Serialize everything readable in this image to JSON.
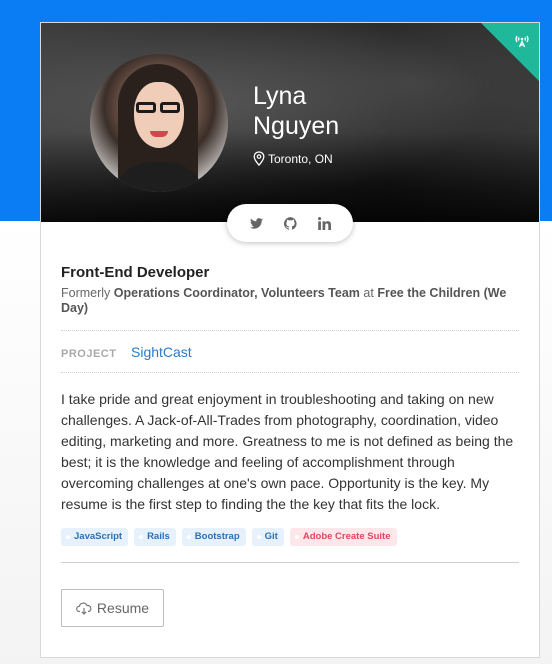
{
  "profile": {
    "first_name": "Lyna",
    "last_name": "Nguyen",
    "location": "Toronto, ON"
  },
  "social": {
    "icons": [
      "twitter-icon",
      "github-icon",
      "linkedin-icon"
    ]
  },
  "job": {
    "title": "Front-End Developer",
    "formerly_prefix": "Formerly",
    "former_role": "Operations Coordinator, Volunteers Team",
    "at": "at",
    "former_org": "Free the Children (We Day)"
  },
  "project": {
    "label": "PROJECT",
    "name": "SightCast"
  },
  "bio": "I take pride and great enjoyment in troubleshooting and taking on new challenges. A Jack-of-All-Trades from photography, coordination, video editing, marketing and more.   Greatness to me is not defined as being the best; it is the knowledge and feeling of accomplishment through overcoming challenges at one's own pace.  Opportunity is the key. My resume is the first step to finding the the key that fits the lock.",
  "skills": [
    {
      "label": "JavaScript",
      "color": "#2b6fb6"
    },
    {
      "label": "Rails",
      "color": "#2b6fb6"
    },
    {
      "label": "Bootstrap",
      "color": "#2b6fb6"
    },
    {
      "label": "Git",
      "color": "#2b6fb6"
    },
    {
      "label": "Adobe Create Suite",
      "color": "#e0465f"
    }
  ],
  "actions": {
    "resume_label": "Resume"
  },
  "colors": {
    "top_bar": "#0a7cf4",
    "corner_badge": "#1fb89a",
    "link": "#2a7ac6"
  }
}
